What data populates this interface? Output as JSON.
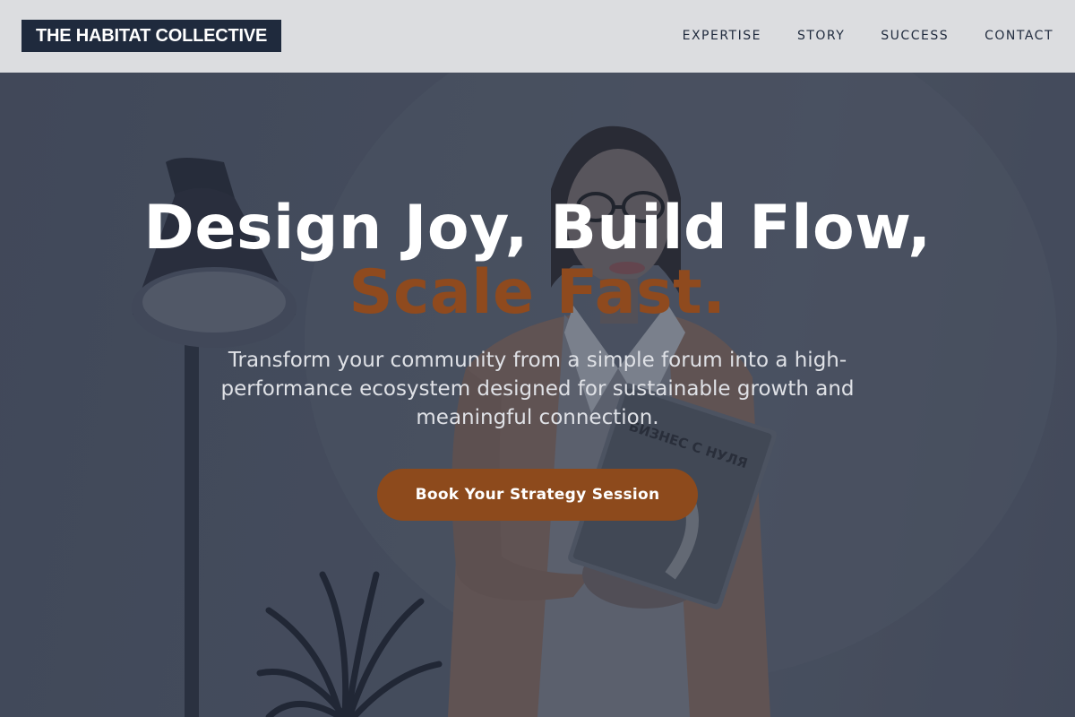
{
  "header": {
    "logo": "THE HABITAT COLLECTIVE",
    "nav": [
      {
        "label": "EXPERTISE"
      },
      {
        "label": "STORY"
      },
      {
        "label": "SUCCESS"
      },
      {
        "label": "CONTACT"
      }
    ]
  },
  "hero": {
    "headline_line1": "Design Joy, Build Flow,",
    "headline_line2": "Scale Fast.",
    "subtitle": "Transform your community from a simple forum into a high-performance ecosystem designed for sustainable growth and meaningful connection.",
    "cta_label": "Book Your Strategy Session",
    "book_cover_text": "БИЗНЕС С НУЛЯ"
  },
  "colors": {
    "header_bg": "#dcdde0",
    "logo_bg": "#1f2a3d",
    "accent": "#8d4a1c",
    "hero_bg": "#4a5263"
  }
}
